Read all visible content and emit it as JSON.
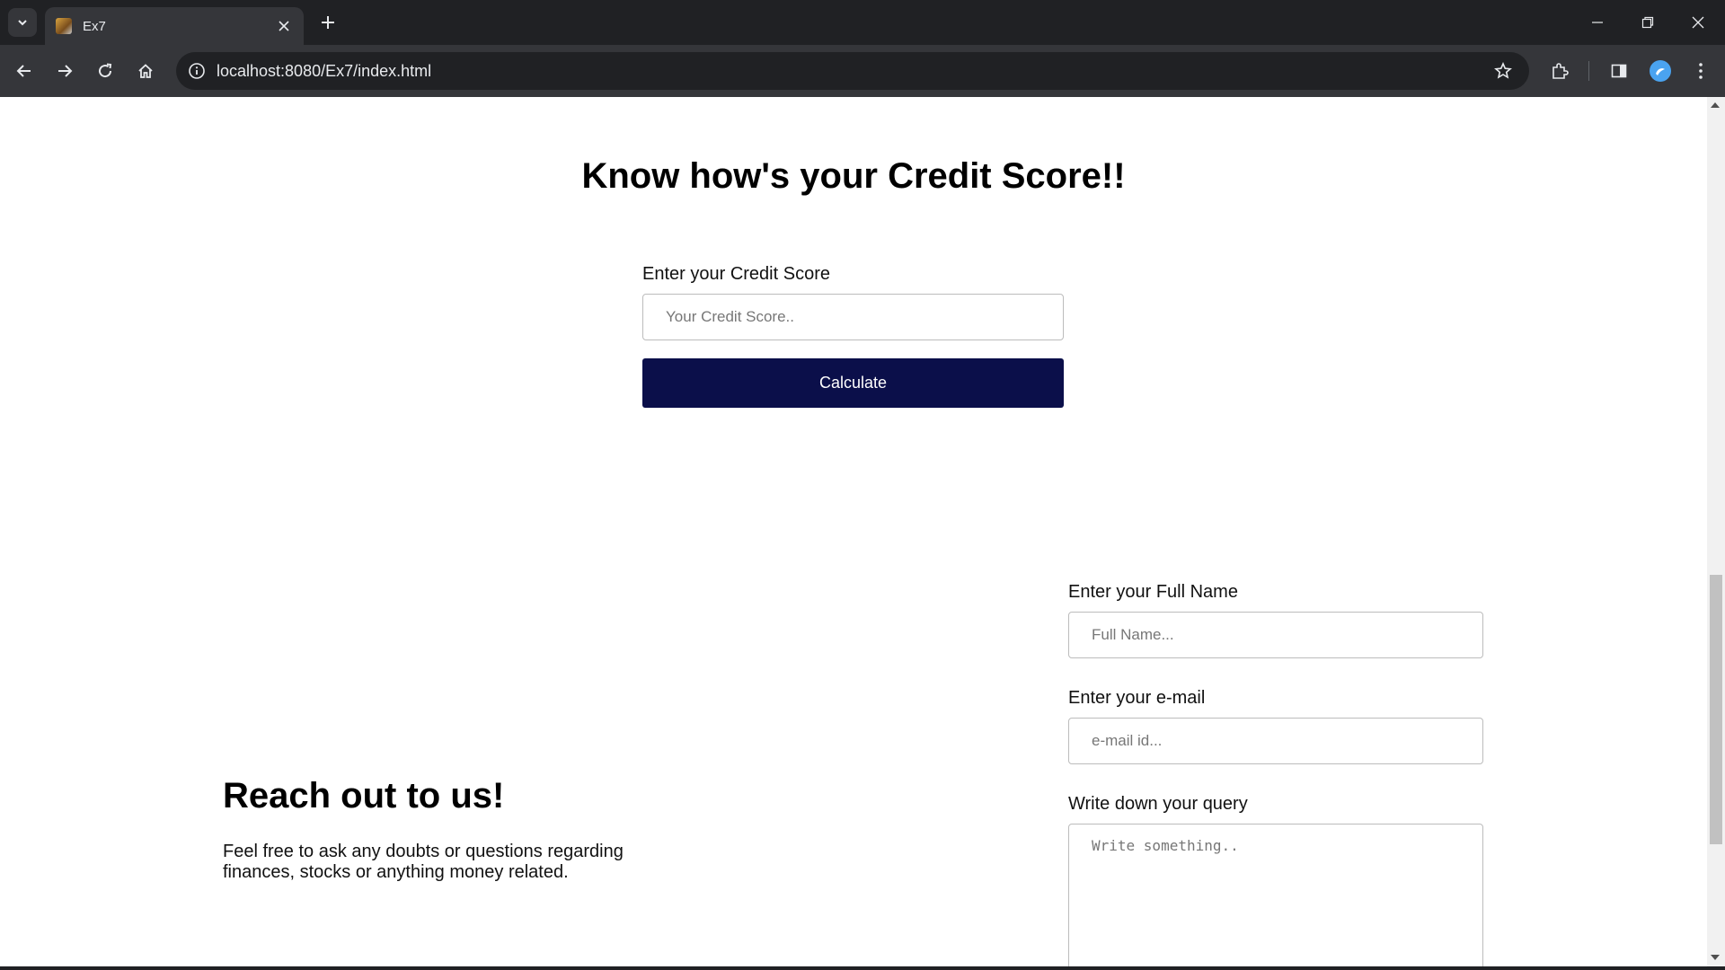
{
  "browser": {
    "tab_title": "Ex7",
    "url": "localhost:8080/Ex7/index.html"
  },
  "credit": {
    "title": "Know how's your Credit Score!!",
    "label": "Enter your Credit Score",
    "placeholder": "Your Credit Score..",
    "button_label": "Calculate"
  },
  "contact": {
    "title": "Reach out to us!",
    "description": "Feel free to ask any doubts or questions regarding finances, stocks or anything money related.",
    "name_label": "Enter your Full Name",
    "name_placeholder": "Full Name...",
    "email_label": "Enter your e-mail",
    "email_placeholder": "e-mail id...",
    "query_label": "Write down your query",
    "query_placeholder": "Write something.."
  },
  "colors": {
    "button_bg": "#0b0f4a",
    "chrome_dark": "#202124",
    "chrome_toolbar": "#35363a",
    "profile_accent": "#4aa3f0"
  }
}
